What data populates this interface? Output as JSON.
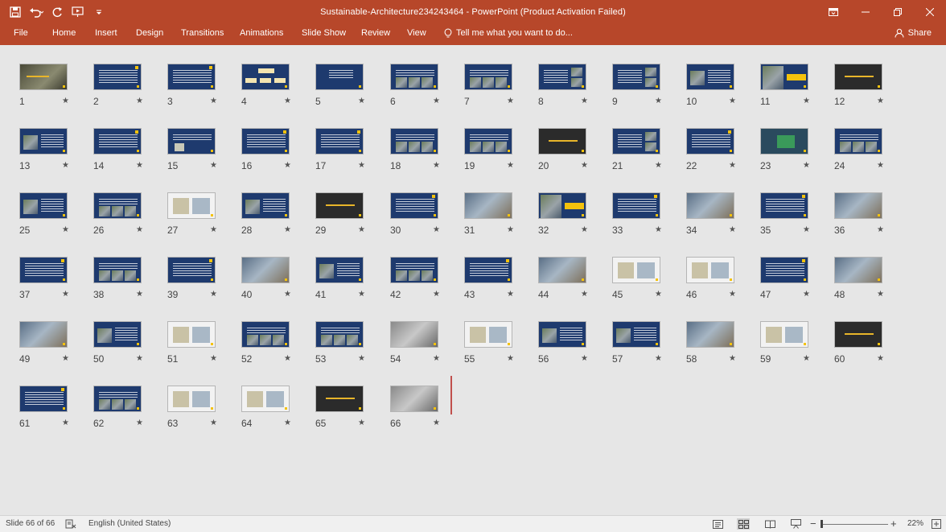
{
  "app": {
    "title": "Sustainable-Architecture234243464 - PowerPoint (Product Activation Failed)",
    "accent_color": "#b7472a"
  },
  "quick_access": [
    {
      "name": "save-icon"
    },
    {
      "name": "undo-icon"
    },
    {
      "name": "redo-icon"
    },
    {
      "name": "slideshow-from-start-icon"
    },
    {
      "name": "customize-toolbar-icon"
    }
  ],
  "window_controls": [
    "ribbon-display-options-icon",
    "minimize-icon",
    "restore-icon",
    "close-icon"
  ],
  "ribbon": {
    "tabs": [
      "File",
      "Home",
      "Insert",
      "Design",
      "Transitions",
      "Animations",
      "Slide Show",
      "Review",
      "View"
    ],
    "tell_me": "Tell me what you want to do...",
    "share": "Share"
  },
  "slides": [
    {
      "n": "1",
      "star": "★",
      "style": "photo-title"
    },
    {
      "n": "2",
      "star": "★",
      "style": "text"
    },
    {
      "n": "3",
      "star": "★",
      "style": "text"
    },
    {
      "n": "4",
      "star": "★",
      "style": "diagram"
    },
    {
      "n": "5",
      "star": "★",
      "style": "text-sparse"
    },
    {
      "n": "6",
      "star": "★",
      "style": "text-photos"
    },
    {
      "n": "7",
      "star": "★",
      "style": "text-photos"
    },
    {
      "n": "8",
      "star": "★",
      "style": "text-side-photos"
    },
    {
      "n": "9",
      "star": "★",
      "style": "text-side-photos"
    },
    {
      "n": "10",
      "star": "★",
      "style": "text-left-photo"
    },
    {
      "n": "11",
      "star": "★",
      "style": "photo-yellow-box"
    },
    {
      "n": "12",
      "star": "★",
      "style": "dark-title"
    },
    {
      "n": "13",
      "star": "★",
      "style": "text-left-photo"
    },
    {
      "n": "14",
      "star": "★",
      "style": "text"
    },
    {
      "n": "15",
      "star": "★",
      "style": "text-small-photo"
    },
    {
      "n": "16",
      "star": "★",
      "style": "text"
    },
    {
      "n": "17",
      "star": "★",
      "style": "text"
    },
    {
      "n": "18",
      "star": "★",
      "style": "text-photos"
    },
    {
      "n": "19",
      "star": "★",
      "style": "text-photos"
    },
    {
      "n": "20",
      "star": "★",
      "style": "dark-title"
    },
    {
      "n": "21",
      "star": "★",
      "style": "text-side-photos"
    },
    {
      "n": "22",
      "star": "★",
      "style": "text"
    },
    {
      "n": "23",
      "star": "★",
      "style": "text-center-photo"
    },
    {
      "n": "24",
      "star": "★",
      "style": "text-photos"
    },
    {
      "n": "25",
      "star": "★",
      "style": "text-left-photo"
    },
    {
      "n": "26",
      "star": "★",
      "style": "text-photos"
    },
    {
      "n": "27",
      "star": "★",
      "style": "light-diagram"
    },
    {
      "n": "28",
      "star": "★",
      "style": "text-left-photo"
    },
    {
      "n": "29",
      "star": "★",
      "style": "dark-title"
    },
    {
      "n": "30",
      "star": "★",
      "style": "text"
    },
    {
      "n": "31",
      "star": "★",
      "style": "photo-full"
    },
    {
      "n": "32",
      "star": "★",
      "style": "photo-yellow-box"
    },
    {
      "n": "33",
      "star": "★",
      "style": "text"
    },
    {
      "n": "34",
      "star": "★",
      "style": "photo-full"
    },
    {
      "n": "35",
      "star": "★",
      "style": "text"
    },
    {
      "n": "36",
      "star": "★",
      "style": "photo-full"
    },
    {
      "n": "37",
      "star": "★",
      "style": "text"
    },
    {
      "n": "38",
      "star": "★",
      "style": "text-photos"
    },
    {
      "n": "39",
      "star": "★",
      "style": "text"
    },
    {
      "n": "40",
      "star": "★",
      "style": "photo-full"
    },
    {
      "n": "41",
      "star": "★",
      "style": "text-left-photo"
    },
    {
      "n": "42",
      "star": "★",
      "style": "text-photos"
    },
    {
      "n": "43",
      "star": "★",
      "style": "text"
    },
    {
      "n": "44",
      "star": "★",
      "style": "photo-full"
    },
    {
      "n": "45",
      "star": "★",
      "style": "light-diagram"
    },
    {
      "n": "46",
      "star": "★",
      "style": "light-diagram"
    },
    {
      "n": "47",
      "star": "★",
      "style": "text"
    },
    {
      "n": "48",
      "star": "★",
      "style": "photo-full"
    },
    {
      "n": "49",
      "star": "★",
      "style": "photo-full"
    },
    {
      "n": "50",
      "star": "★",
      "style": "text-left-photo"
    },
    {
      "n": "51",
      "star": "★",
      "style": "light-diagram"
    },
    {
      "n": "52",
      "star": "★",
      "style": "text-photos"
    },
    {
      "n": "53",
      "star": "★",
      "style": "text-photos"
    },
    {
      "n": "54",
      "star": "★",
      "style": "photo-gray"
    },
    {
      "n": "55",
      "star": "★",
      "style": "light-diagram"
    },
    {
      "n": "56",
      "star": "★",
      "style": "text-left-photo"
    },
    {
      "n": "57",
      "star": "★",
      "style": "text-left-photo"
    },
    {
      "n": "58",
      "star": "★",
      "style": "photo-full"
    },
    {
      "n": "59",
      "star": "★",
      "style": "light-diagram"
    },
    {
      "n": "60",
      "star": "★",
      "style": "dark-title"
    },
    {
      "n": "61",
      "star": "★",
      "style": "text"
    },
    {
      "n": "62",
      "star": "★",
      "style": "text-photos"
    },
    {
      "n": "63",
      "star": "★",
      "style": "light-diagram"
    },
    {
      "n": "64",
      "star": "★",
      "style": "light-diagram"
    },
    {
      "n": "65",
      "star": "★",
      "style": "dark-title"
    },
    {
      "n": "66",
      "star": "★",
      "style": "photo-gray"
    }
  ],
  "status": {
    "slide_info": "Slide 66 of 66",
    "language": "English (United States)",
    "zoom": "22%",
    "zoom_minus": "−",
    "zoom_plus": "+"
  }
}
